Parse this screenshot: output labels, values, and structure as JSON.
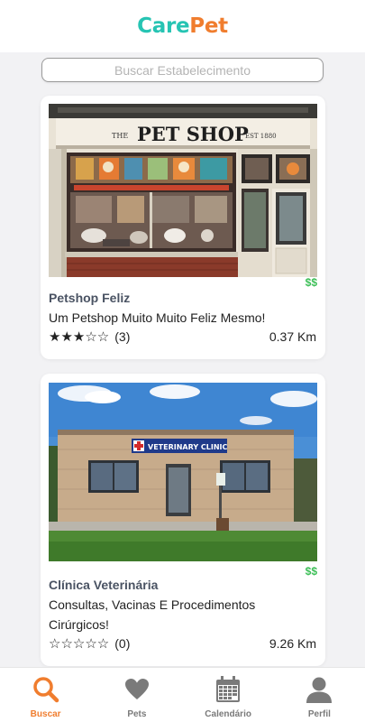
{
  "app": {
    "logo_part1": "Care",
    "logo_part2": "Pet"
  },
  "search": {
    "placeholder": "Buscar Estabelecimento"
  },
  "colors": {
    "brand_teal": "#26c4b3",
    "brand_orange": "#f07d2e",
    "price_green": "#3cbf57",
    "tab_inactive": "#7a7a7a"
  },
  "establishments": [
    {
      "price": "$$",
      "name": "Petshop Feliz",
      "description": "Um Petshop Muito Muito Feliz Mesmo!",
      "stars": "★★★☆☆",
      "rating": 3,
      "review_count": "(3)",
      "distance": "0.37 Km",
      "image_sign_main": "PET SHOP",
      "image_sign_left": "THE",
      "image_sign_right": "EST 1880"
    },
    {
      "price": "$$",
      "name": "Clínica Veterinária",
      "description": "Consultas, Vacinas E Procedimentos Cirúrgicos!",
      "stars": "☆☆☆☆☆",
      "rating": 0,
      "review_count": "(0)",
      "distance": "9.26 Km",
      "image_sign_main": "VETERINARY CLINIC"
    }
  ],
  "tabs": [
    {
      "label": "Buscar",
      "icon": "search-icon",
      "active": true
    },
    {
      "label": "Pets",
      "icon": "heart-icon",
      "active": false
    },
    {
      "label": "Calendário",
      "icon": "calendar-icon",
      "active": false
    },
    {
      "label": "Perfil",
      "icon": "user-icon",
      "active": false
    }
  ]
}
